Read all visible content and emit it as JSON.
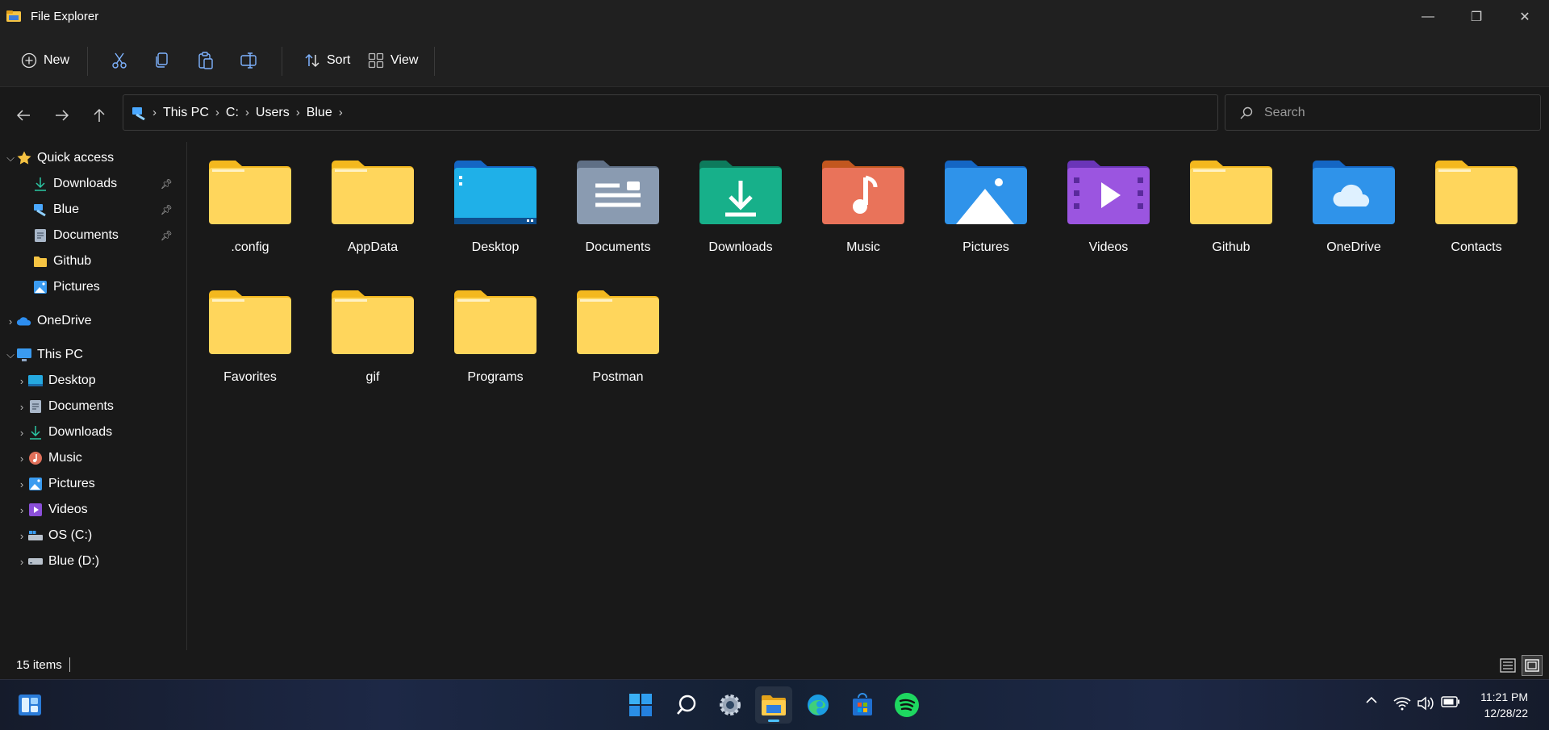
{
  "window": {
    "title": "File Explorer"
  },
  "window_controls": {
    "minimize": "—",
    "restore": "❐",
    "close": "✕"
  },
  "toolbar": {
    "new_label": "New",
    "sort_label": "Sort",
    "view_label": "View"
  },
  "breadcrumb": [
    "This PC",
    "C:",
    "Users",
    "Blue"
  ],
  "search": {
    "placeholder": "Search"
  },
  "sidebar": {
    "quick_access": {
      "label": "Quick access",
      "items": [
        {
          "label": "Downloads",
          "icon": "download-icon",
          "pinned": true
        },
        {
          "label": "Blue",
          "icon": "user-folder-icon",
          "pinned": true
        },
        {
          "label": "Documents",
          "icon": "documents-icon",
          "pinned": true
        },
        {
          "label": "Github",
          "icon": "folder-icon",
          "pinned": false
        },
        {
          "label": "Pictures",
          "icon": "pictures-icon",
          "pinned": false
        }
      ]
    },
    "onedrive": {
      "label": "OneDrive"
    },
    "this_pc": {
      "label": "This PC",
      "items": [
        {
          "label": "Desktop",
          "icon": "desktop-icon"
        },
        {
          "label": "Documents",
          "icon": "documents-icon"
        },
        {
          "label": "Downloads",
          "icon": "download-icon"
        },
        {
          "label": "Music",
          "icon": "music-icon"
        },
        {
          "label": "Pictures",
          "icon": "pictures-icon"
        },
        {
          "label": "Videos",
          "icon": "videos-icon"
        },
        {
          "label": "OS (C:)",
          "icon": "os-drive-icon"
        },
        {
          "label": "Blue (D:)",
          "icon": "drive-icon"
        }
      ]
    }
  },
  "folders": [
    {
      "name": ".config",
      "type": "plain"
    },
    {
      "name": "AppData",
      "type": "plain"
    },
    {
      "name": "Desktop",
      "type": "desktop"
    },
    {
      "name": "Documents",
      "type": "documents"
    },
    {
      "name": "Downloads",
      "type": "downloads"
    },
    {
      "name": "Music",
      "type": "music"
    },
    {
      "name": "Pictures",
      "type": "pictures"
    },
    {
      "name": "Videos",
      "type": "videos"
    },
    {
      "name": "Github",
      "type": "plain"
    },
    {
      "name": "OneDrive",
      "type": "onedrive"
    },
    {
      "name": "Contacts",
      "type": "plain"
    },
    {
      "name": "Favorites",
      "type": "plain"
    },
    {
      "name": "gif",
      "type": "plain"
    },
    {
      "name": "Programs",
      "type": "plain"
    },
    {
      "name": "Postman",
      "type": "plain"
    }
  ],
  "status": {
    "item_count": "15 items"
  },
  "taskbar": {
    "apps": [
      "widgets-icon",
      "start-icon",
      "search-icon",
      "settings-icon",
      "file-explorer-icon",
      "edge-icon",
      "store-icon",
      "spotify-icon"
    ],
    "active_app": "file-explorer-icon",
    "clock": {
      "time": "11:21 PM",
      "date": "12/28/22"
    }
  },
  "colors": {
    "background": "#191919",
    "chrome": "#202020",
    "accent": "#4cc2ff",
    "folder_yellow": "#ffd65c"
  }
}
